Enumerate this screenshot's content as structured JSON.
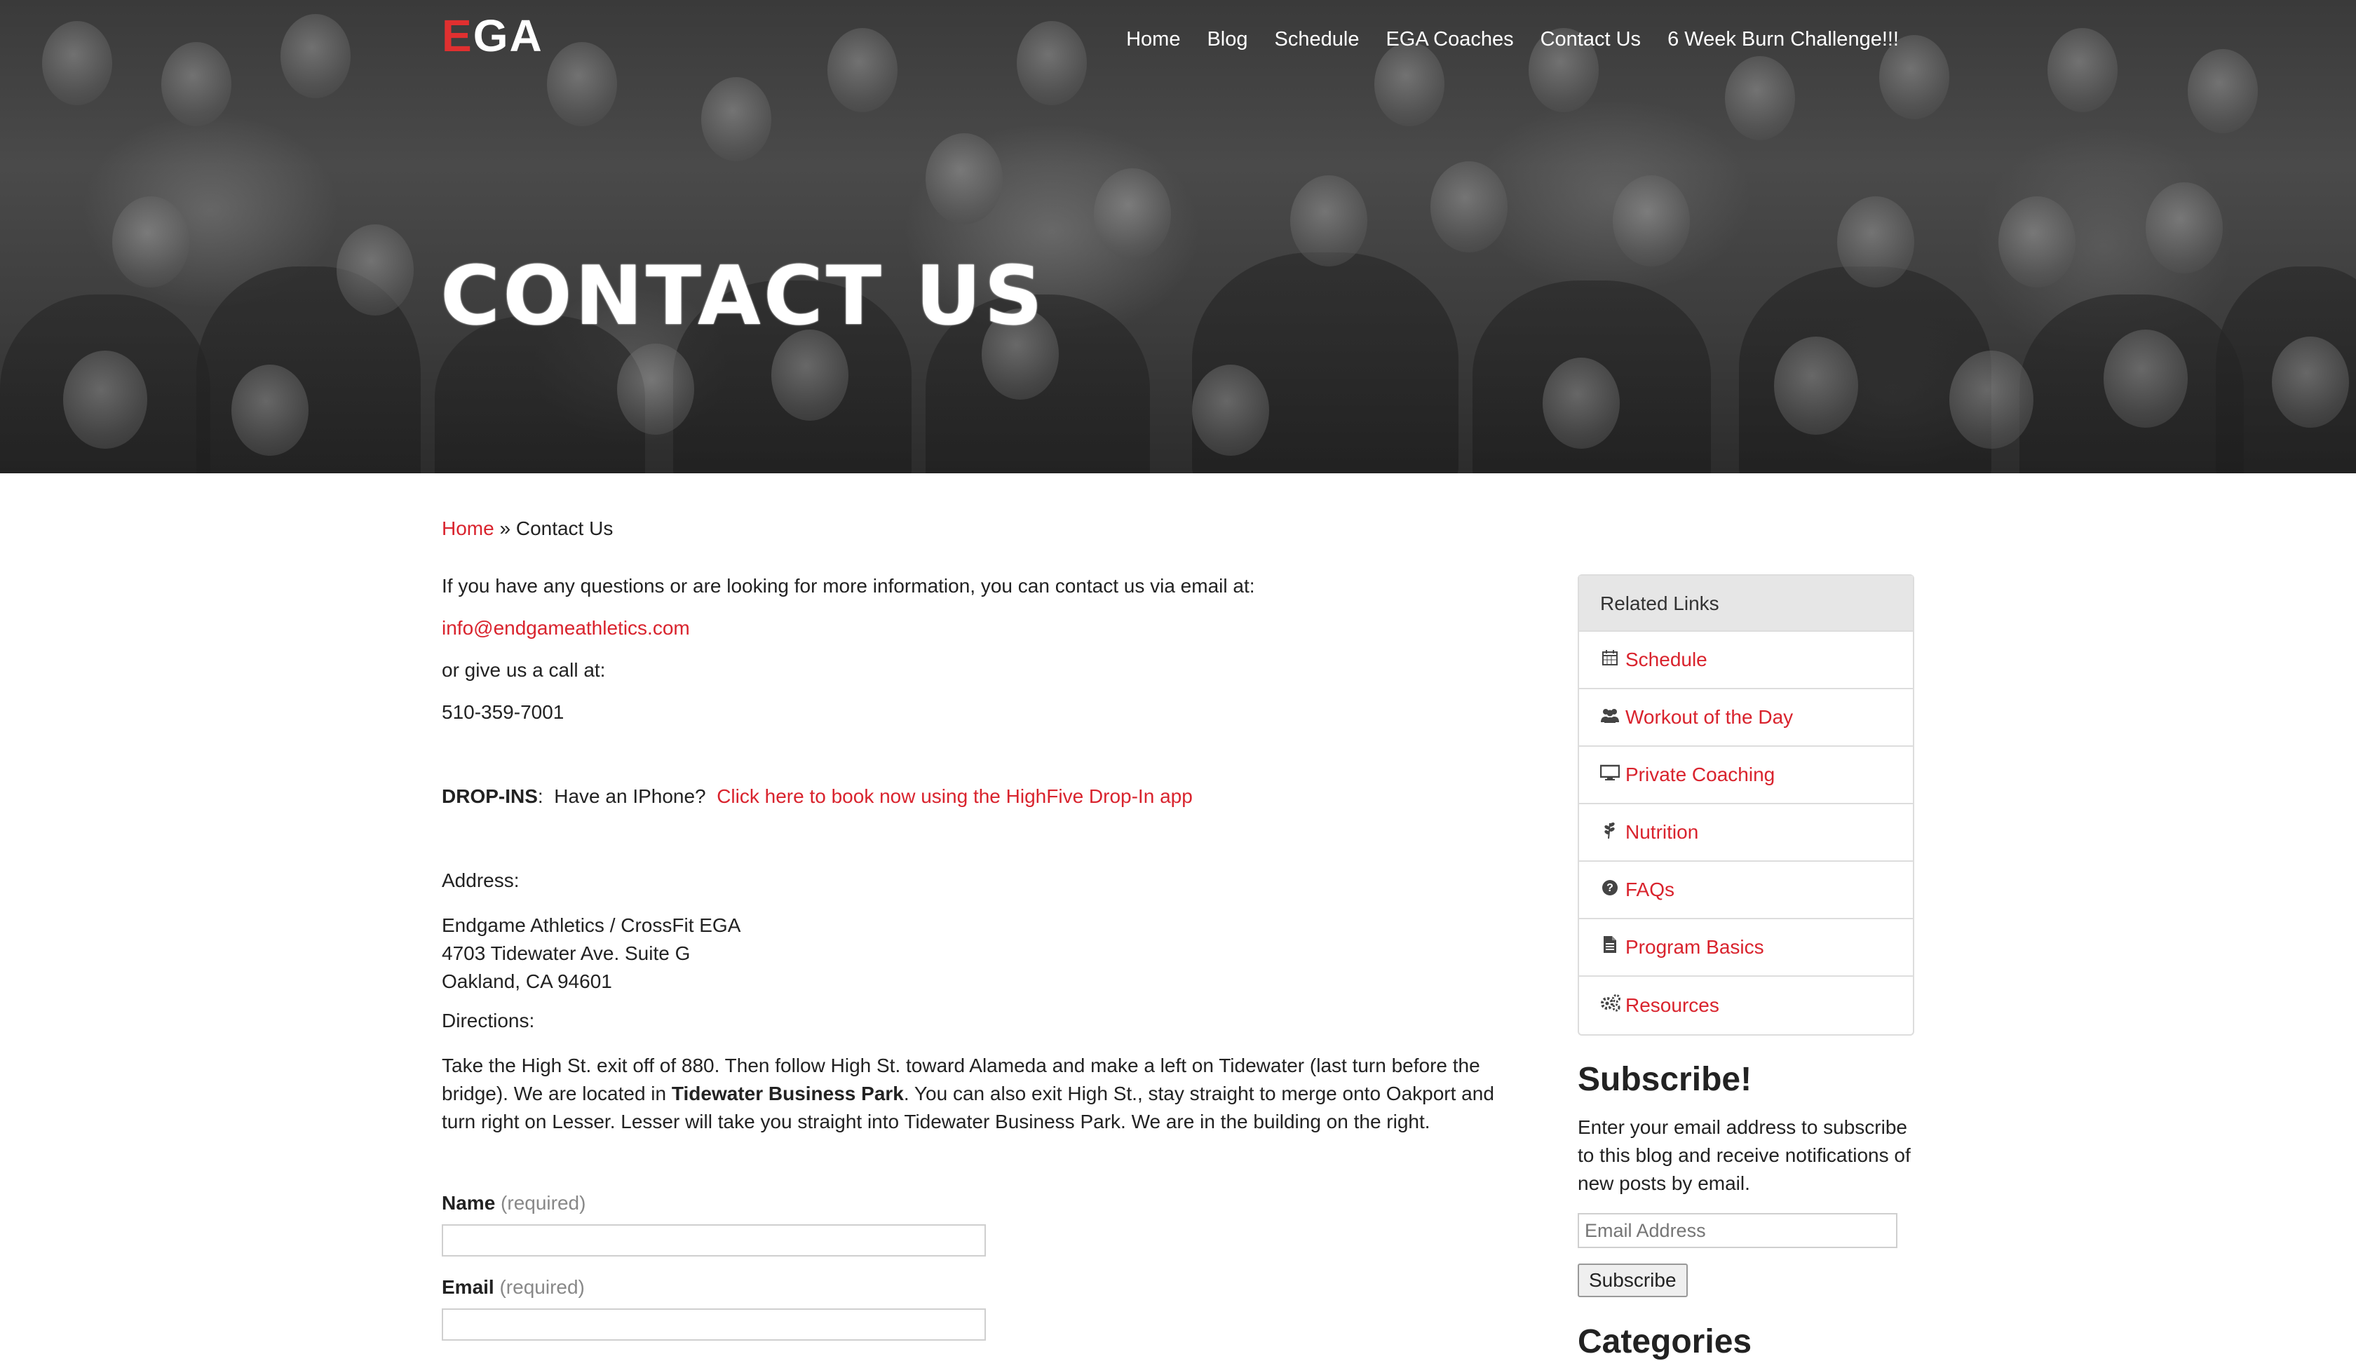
{
  "header": {
    "logo_text": "EGA",
    "logo_accent_letter": "E",
    "nav": [
      {
        "label": "Home"
      },
      {
        "label": "Blog"
      },
      {
        "label": "Schedule"
      },
      {
        "label": "EGA Coaches"
      },
      {
        "label": "Contact Us"
      },
      {
        "label": "6 Week Burn Challenge!!!"
      }
    ]
  },
  "hero": {
    "title": "CONTACT US"
  },
  "breadcrumb": {
    "home": "Home",
    "separator": " » ",
    "current": "Contact Us"
  },
  "content": {
    "intro": "If you have any questions or are looking for more information, you can contact us via email at:",
    "email": "info@endgameathletics.com",
    "call_text": "or give us a call at:",
    "phone": "510-359-7001",
    "dropins_label": "DROP-INS",
    "dropins_text": ":  Have an IPhone?",
    "dropins_link": "Click here to book now using the HighFive Drop-In app",
    "address_label": "Address:",
    "address_line1": "Endgame Athletics / CrossFit EGA",
    "address_line2": "4703 Tidewater Ave. Suite G",
    "address_line3": "Oakland, CA 94601",
    "directions_label": "Directions:",
    "directions_part1": "Take the High St. exit off of 880. Then follow High St. toward Alameda and make a left on Tidewater (last turn before the bridge). We are located in ",
    "directions_bold": "Tidewater Business Park",
    "directions_part2": ". You can also exit High St., stay straight to merge onto Oakport and turn right on Lesser. Lesser will take you straight into Tidewater Business Park. We are in the building on the right."
  },
  "form": {
    "name_label": "Name",
    "name_required": "(required)",
    "email_label": "Email",
    "email_required": "(required)"
  },
  "sidebar": {
    "related_title": "Related Links",
    "links": [
      {
        "label": "Schedule",
        "icon": "calendar-icon"
      },
      {
        "label": "Workout of the Day",
        "icon": "users-icon"
      },
      {
        "label": "Private Coaching",
        "icon": "monitor-icon"
      },
      {
        "label": "Nutrition",
        "icon": "wheat-icon"
      },
      {
        "label": "FAQs",
        "icon": "question-circle-icon"
      },
      {
        "label": "Program Basics",
        "icon": "document-icon"
      },
      {
        "label": "Resources",
        "icon": "gears-icon"
      }
    ],
    "subscribe_title": "Subscribe!",
    "subscribe_text": "Enter your email address to subscribe to this blog and receive notifications of new posts by email.",
    "subscribe_placeholder": "Email Address",
    "subscribe_button": "Subscribe",
    "categories_title": "Categories"
  },
  "colors": {
    "accent": "#d9232d",
    "text": "#222222",
    "panel_header": "#e6e6e6"
  }
}
